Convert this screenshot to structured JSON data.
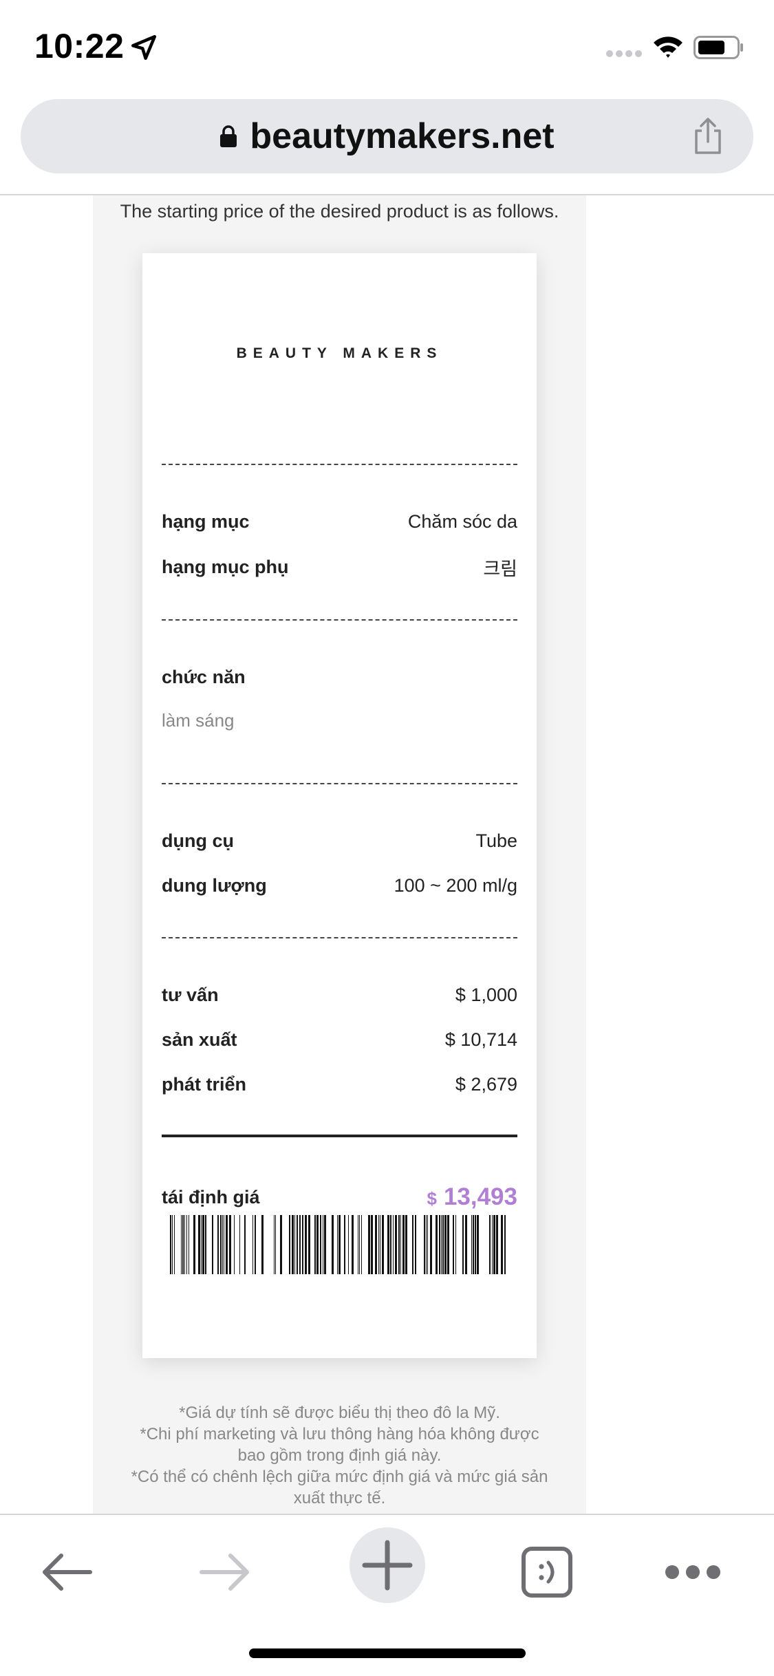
{
  "status_bar": {
    "time": "10:22"
  },
  "browser": {
    "url": "beautymakers.net"
  },
  "page": {
    "intro": "The starting price of the desired product is as follows.",
    "receipt": {
      "brand": "BEAUTY MAKERS",
      "category_label": "hạng mục",
      "category_value": "Chăm sóc da",
      "subcategory_label": "hạng mục phụ",
      "subcategory_value": "크림",
      "function_label": "chức năn",
      "function_value": "làm sáng",
      "container_label": "dụng cụ",
      "container_value": "Tube",
      "capacity_label": "dung lượng",
      "capacity_value": "100 ~ 200 ml/g",
      "consulting_label": "tư vấn",
      "consulting_value": "$ 1,000",
      "production_label": "sản xuất",
      "production_value": "$ 10,714",
      "development_label": "phát triển",
      "development_value": "$ 2,679",
      "total_label": "tái định giá",
      "total_currency": "$",
      "total_amount": "13,493",
      "accent_color": "#b07fd4"
    },
    "footnotes": [
      "*Giá dự tính sẽ được biểu thị theo đô la Mỹ.",
      "*Chi phí marketing và lưu thông hàng hóa không được bao gồm trong định giá này.",
      "*Có thể có chênh lệch giữa mức định giá và mức giá sản xuất thực tế."
    ]
  },
  "toolbar": {
    "icons": [
      "back-arrow-icon",
      "forward-arrow-icon",
      "plus-icon",
      "tabs-icon",
      "more-icon"
    ]
  }
}
